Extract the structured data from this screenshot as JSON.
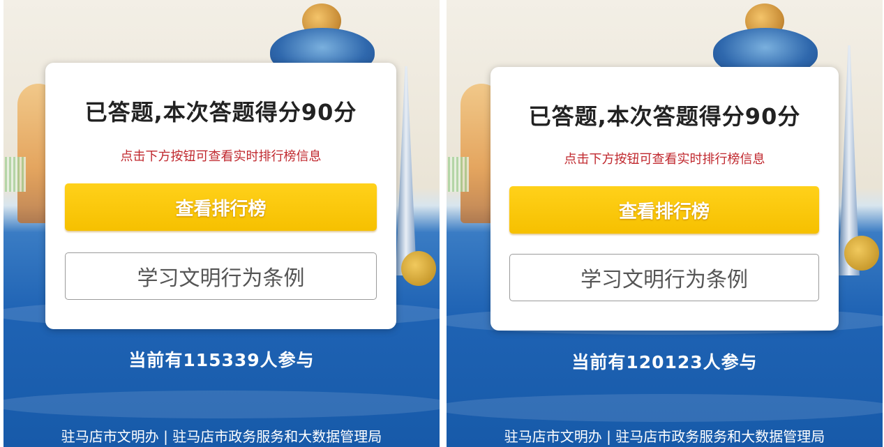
{
  "screens": [
    {
      "score_title": "已答题,本次答题得分90分",
      "hint": "点击下方按钮可查看实时排行榜信息",
      "leaderboard_button": "查看排行榜",
      "learn_button": "学习文明行为条例",
      "participants": "当前有115339人参与",
      "footer": "驻马店市文明办 | 驻马店市政务服务和大数据管理局"
    },
    {
      "score_title": "已答题,本次答题得分90分",
      "hint": "点击下方按钮可查看实时排行榜信息",
      "leaderboard_button": "查看排行榜",
      "learn_button": "学习文明行为条例",
      "participants": "当前有120123人参与",
      "footer": "驻马店市文明办 | 驻马店市政务服务和大数据管理局"
    }
  ],
  "colors": {
    "primary_button": "#f6c000",
    "hint_text": "#c0282e",
    "background_water": "#1f63b4"
  }
}
